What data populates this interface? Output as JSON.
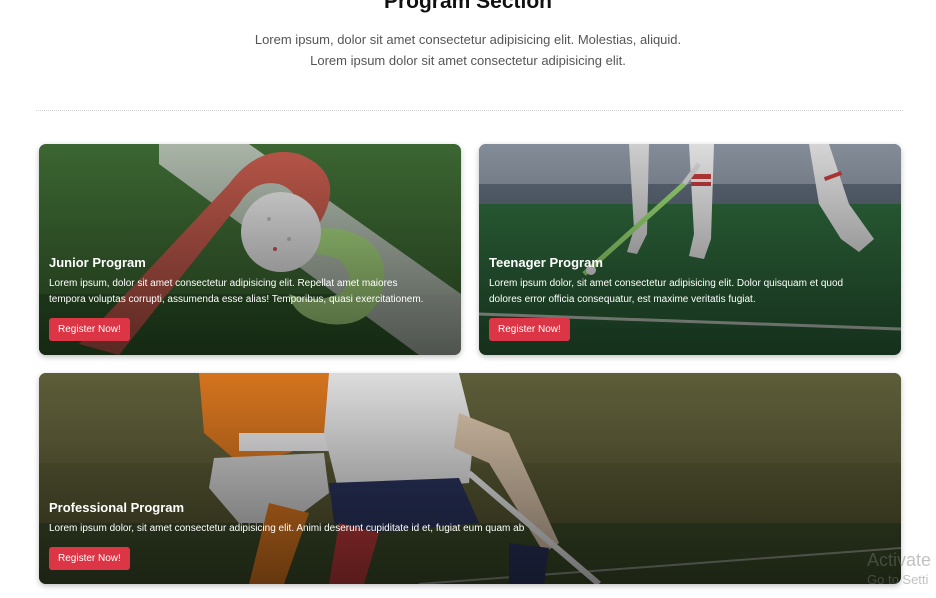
{
  "section": {
    "title": "Program Section",
    "description_line1": "Lorem ipsum, dolor sit amet consectetur adipisicing elit. Molestias, aliquid.",
    "description_line2": "Lorem ipsum dolor sit amet consectetur adipisicing elit."
  },
  "cards": [
    {
      "title": "Junior Program",
      "text_line1": "Lorem ipsum, dolor sit amet consectetur adipisicing elit. Repellat amet maiores",
      "text_line2": "tempora voluptas corrupti, assumenda esse alias! Temporibus, quasi exercitationem.",
      "button": "Register Now!"
    },
    {
      "title": "Teenager Program",
      "text_line1": "Lorem ipsum dolor, sit amet consectetur adipisicing elit. Dolor quisquam et quod",
      "text_line2": "dolores error officia consequatur, est maxime veritatis fugiat.",
      "button": "Register Now!"
    },
    {
      "title": "Professional Program",
      "text_line1": "Lorem ipsum dolor, sit amet consectetur adipisicing elit. Animi deserunt cupiditate id et, fugiat eum quam ab",
      "button": "Register Now!"
    }
  ],
  "watermark": {
    "line1": "Activate",
    "line2": "Go to Setti"
  },
  "colors": {
    "button": "#dc3545",
    "turf": "#3f6b3a"
  }
}
